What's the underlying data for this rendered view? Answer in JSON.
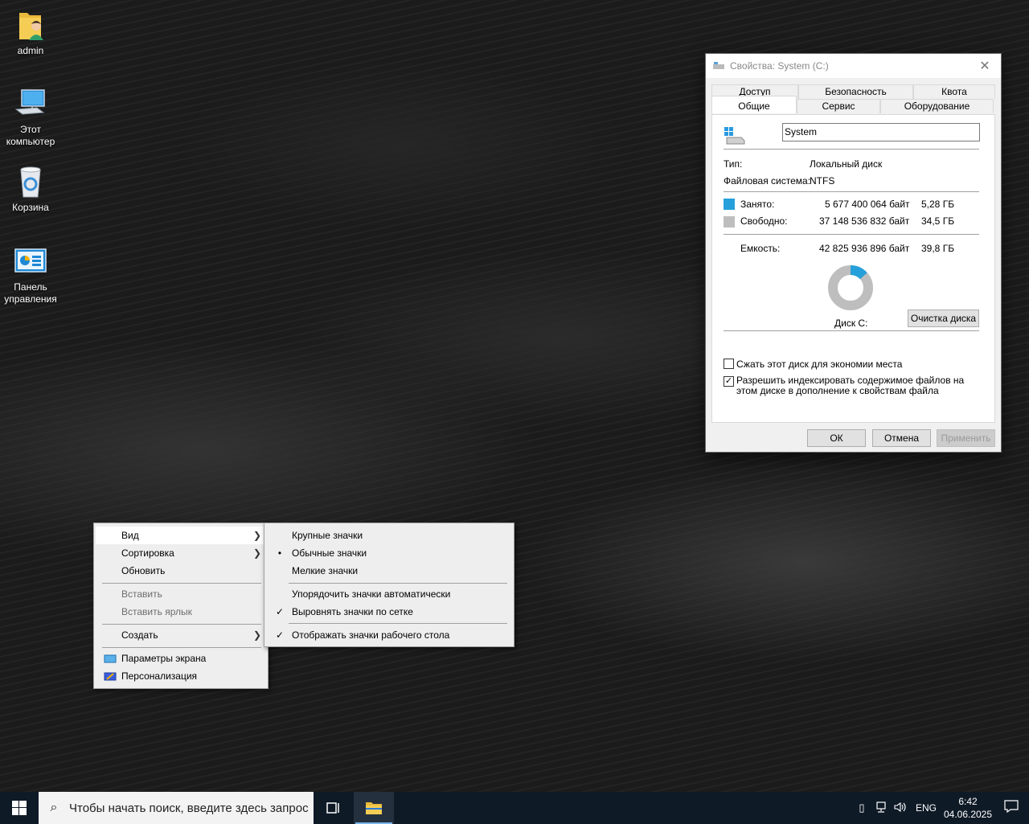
{
  "desktop": {
    "icons": [
      {
        "label": "admin",
        "icon": "user-folder-icon"
      },
      {
        "label": "Этот компьютер",
        "icon": "computer-icon"
      },
      {
        "label": "Корзина",
        "icon": "recycle-bin-icon"
      },
      {
        "label": "Панель управления",
        "icon": "control-panel-icon"
      }
    ]
  },
  "dialog": {
    "title": "Свойства: System (C:)",
    "close": "✕",
    "tabs_back": [
      "Доступ",
      "Безопасность",
      "Квота"
    ],
    "tabs_front": [
      "Общие",
      "Сервис",
      "Оборудование"
    ],
    "active_tab": "Общие",
    "name_value": "System",
    "type_label": "Тип:",
    "type_value": "Локальный диск",
    "fs_label": "Файловая система:",
    "fs_value": "NTFS",
    "used_label": "Занято:",
    "used_bytes": "5 677 400 064 байт",
    "used_gb": "5,28 ГБ",
    "free_label": "Свободно:",
    "free_bytes": "37 148 536 832 байт",
    "free_gb": "34,5 ГБ",
    "cap_label": "Емкость:",
    "cap_bytes": "42 825 936 896 байт",
    "cap_gb": "39,8 ГБ",
    "used_fraction": 0.1326,
    "disk_label": "Диск C:",
    "cleanup_button": "Очистка диска",
    "compress_label": "Сжать этот диск для экономии места",
    "compress_checked": false,
    "index_label": "Разрешить индексировать содержимое файлов на этом диске в дополнение к свойствам файла",
    "index_checked": true,
    "ok_button": "ОК",
    "cancel_button": "Отмена",
    "apply_button": "Применить",
    "colors": {
      "used": "#26a0da",
      "free": "#bebebe"
    }
  },
  "context_menu": {
    "items": [
      {
        "label": "Вид",
        "submenu": true
      },
      {
        "label": "Сортировка",
        "submenu": true
      },
      {
        "label": "Обновить"
      },
      {
        "label": "Вставить",
        "disabled": true
      },
      {
        "label": "Вставить ярлык",
        "disabled": true
      },
      {
        "label": "Создать",
        "submenu": true
      },
      {
        "label": "Параметры экрана",
        "icon": "display-settings-icon"
      },
      {
        "label": "Персонализация",
        "icon": "personalization-icon"
      }
    ]
  },
  "view_submenu": {
    "items": [
      {
        "label": "Крупные значки"
      },
      {
        "label": "Обычные значки",
        "mark": "•"
      },
      {
        "label": "Мелкие значки"
      },
      {
        "label": "Упорядочить значки автоматически"
      },
      {
        "label": "Выровнять значки по сетке",
        "mark": "✓"
      },
      {
        "label": "Отображать значки рабочего стола",
        "mark": "✓"
      }
    ]
  },
  "taskbar": {
    "search_placeholder": "Чтобы начать поиск, введите здесь запрос",
    "lang": "ENG",
    "time": "6:42",
    "date": "04.06.2025"
  }
}
